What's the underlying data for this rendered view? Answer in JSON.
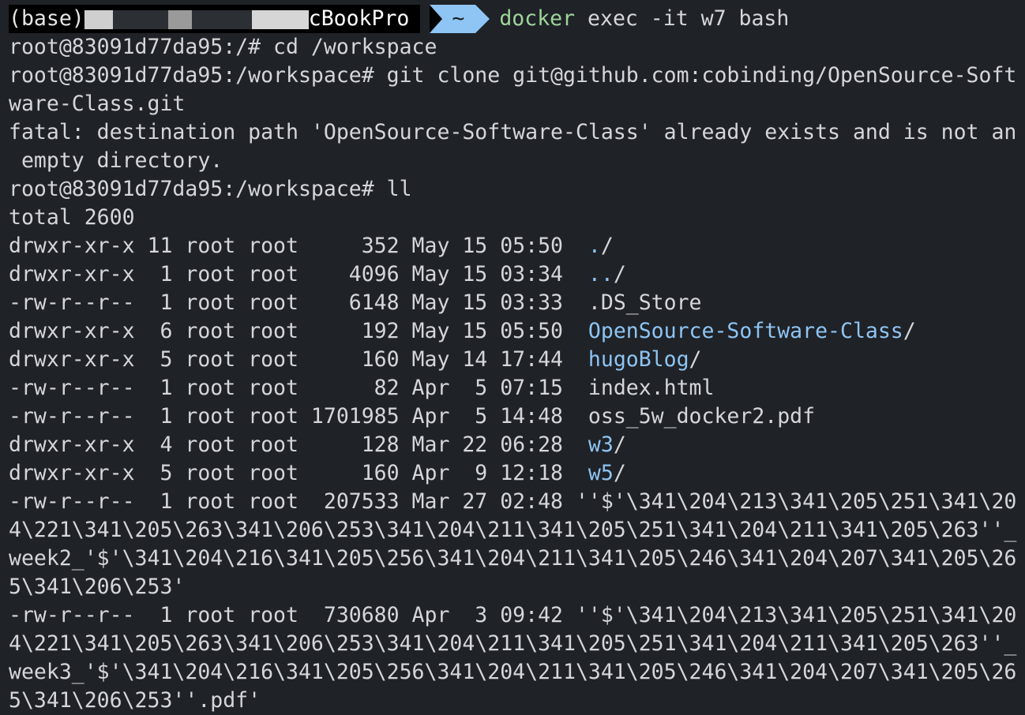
{
  "prompt": {
    "env": "(base)",
    "host_suffix": "cBookPro",
    "dir": "~",
    "command": "docker",
    "command_args": " exec -it w7 bash"
  },
  "lines_before_ls": [
    "root@83091d77da95:/# cd /workspace",
    "root@83091d77da95:/workspace# git clone git@github.com:cobinding/OpenSource-Soft",
    "ware-Class.git",
    "fatal: destination path 'OpenSource-Software-Class' already exists and is not an",
    " empty directory.",
    "root@83091d77da95:/workspace# ll",
    "total 2600"
  ],
  "listing": [
    {
      "meta": "drwxr-xr-x 11 root root     352 May 15 05:50  ",
      "name": ".",
      "suffix": "/",
      "is_dir": true,
      "bold": false
    },
    {
      "meta": "drwxr-xr-x  1 root root    4096 May 15 03:34  ",
      "name": "..",
      "suffix": "/",
      "is_dir": true,
      "bold": false
    },
    {
      "meta": "-rw-r--r--  1 root root    6148 May 15 03:33  ",
      "name": ".DS_Store",
      "suffix": "",
      "is_dir": false,
      "bold": false
    },
    {
      "meta": "drwxr-xr-x  6 root root     192 May 15 05:50  ",
      "name": "OpenSource-Software-Class",
      "suffix": "/",
      "is_dir": true,
      "bold": false
    },
    {
      "meta": "drwxr-xr-x  5 root root     160 May 14 17:44  ",
      "name": "hugoBlog",
      "suffix": "/",
      "is_dir": true,
      "bold": false
    },
    {
      "meta": "-rw-r--r--  1 root root      82 Apr  5 07:15  ",
      "name": "index.html",
      "suffix": "",
      "is_dir": false,
      "bold": false
    },
    {
      "meta": "-rw-r--r--  1 root root 1701985 Apr  5 14:48  ",
      "name": "oss_5w_docker2.pdf",
      "suffix": "",
      "is_dir": false,
      "bold": false
    },
    {
      "meta": "drwxr-xr-x  4 root root     128 Mar 22 06:28  ",
      "name": "w3",
      "suffix": "/",
      "is_dir": true,
      "bold": false
    },
    {
      "meta": "drwxr-xr-x  5 root root     160 Apr  9 12:18  ",
      "name": "w5",
      "suffix": "/",
      "is_dir": true,
      "bold": false
    }
  ],
  "lines_after_ls": [
    "-rw-r--r--  1 root root  207533 Mar 27 02:48 ''$'\\341\\204\\213\\341\\205\\251\\341\\20",
    "4\\221\\341\\205\\263\\341\\206\\253\\341\\204\\211\\341\\205\\251\\341\\204\\211\\341\\205\\263''_",
    "week2_'$'\\341\\204\\216\\341\\205\\256\\341\\204\\211\\341\\205\\246\\341\\204\\207\\341\\205\\26",
    "5\\341\\206\\253'",
    "-rw-r--r--  1 root root  730680 Apr  3 09:42 ''$'\\341\\204\\213\\341\\205\\251\\341\\20",
    "4\\221\\341\\205\\263\\341\\206\\253\\341\\204\\211\\341\\205\\251\\341\\204\\211\\341\\205\\263''_",
    "week3_'$'\\341\\204\\216\\341\\205\\256\\341\\204\\211\\341\\205\\246\\341\\204\\207\\341\\205\\26",
    "5\\341\\206\\253''.pdf'"
  ],
  "colors": {
    "background": "#1f2227",
    "text": "#d4d6da",
    "directory": "#8ec5f4",
    "command": "#9fd49b",
    "prompt_dir_bg": "#8ec5f4"
  }
}
